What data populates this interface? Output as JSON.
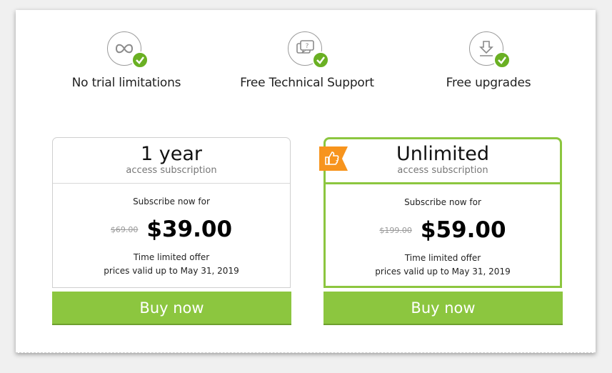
{
  "features": [
    {
      "label": "No trial limitations",
      "icon": "infinity-icon"
    },
    {
      "label": "Free Technical Support",
      "icon": "support-chat-icon"
    },
    {
      "label": "Free upgrades",
      "icon": "download-icon"
    }
  ],
  "plans": [
    {
      "title": "1 year",
      "subtitle": "access subscription",
      "subscribe_text": "Subscribe now for",
      "old_price": "$69.00",
      "price": "$39.00",
      "offer_line1": "Time limited offer",
      "offer_line2": "prices valid up to May 31, 2019",
      "button": "Buy now",
      "featured": false
    },
    {
      "title": "Unlimited",
      "subtitle": "access subscription",
      "subscribe_text": "Subscribe now for",
      "old_price": "$199.00",
      "price": "$59.00",
      "offer_line1": "Time limited offer",
      "offer_line2": "prices valid up to May 31, 2019",
      "button": "Buy now",
      "featured": true,
      "badge_icon": "thumbs-up-icon"
    }
  ],
  "colors": {
    "accent_green": "#8cc63f",
    "check_green": "#6ab023",
    "badge_orange": "#f7941d"
  }
}
